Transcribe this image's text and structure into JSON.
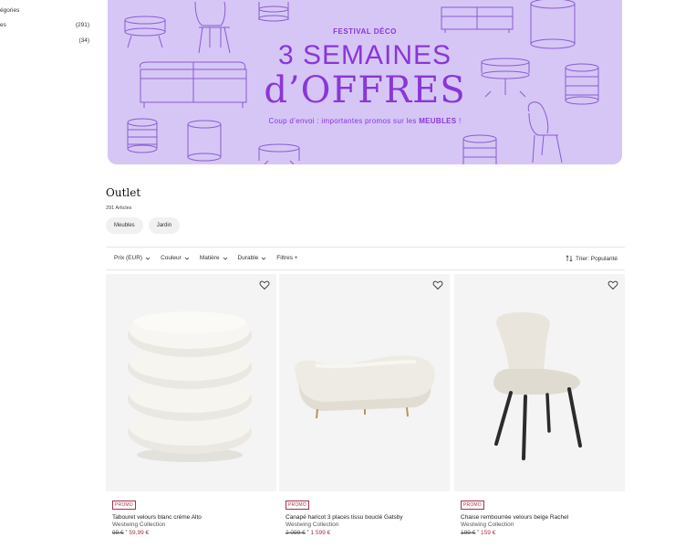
{
  "sidebar": {
    "heading": "égories",
    "rows": [
      {
        "label": "es",
        "count": "(291)"
      },
      {
        "label": "",
        "count": "(34)"
      }
    ]
  },
  "banner": {
    "tag": "FESTIVAL DÉCO",
    "line1": "3 SEMAINES",
    "line2": "d’OFFRES",
    "subtitle_pre": "Coup d’envoi : importantes promos sur les ",
    "subtitle_strong": "MEUBLES",
    "subtitle_post": " !",
    "color_bg": "#d6c6f6",
    "color_text": "#8a36d8"
  },
  "page": {
    "title": "Outlet",
    "count": "291 Articles",
    "chips": [
      "Meubles",
      "Jardin"
    ]
  },
  "filterbar": {
    "filters": [
      "Prix (EUR)",
      "Couleur",
      "Matière",
      "Durable"
    ],
    "more": "Filtres +",
    "sort_label": "Trier: Popularité"
  },
  "products": [
    {
      "badge": "PROMO",
      "name": "Tabouret velours blanc crème Alto",
      "brand": "Westwing Collection",
      "old_price": "99 €",
      "star": "*",
      "new_price": "59,99 €",
      "icon": "heart-icon"
    },
    {
      "badge": "PROMO",
      "name": "Canapé haricot 3 places tissu bouclé Gatsby",
      "brand": "Westwing Collection",
      "old_price": "2 099 €",
      "star": "*",
      "new_price": "1 599 €",
      "icon": "heart-icon"
    },
    {
      "badge": "PROMO",
      "name": "Chaise rembourrée velours beige Rachel",
      "brand": "Westwing Collection",
      "old_price": "199 €",
      "star": "*",
      "new_price": "159 €",
      "icon": "heart-icon"
    }
  ],
  "colors": {
    "promo": "#a4314a",
    "card_bg": "#f4f4f4"
  }
}
